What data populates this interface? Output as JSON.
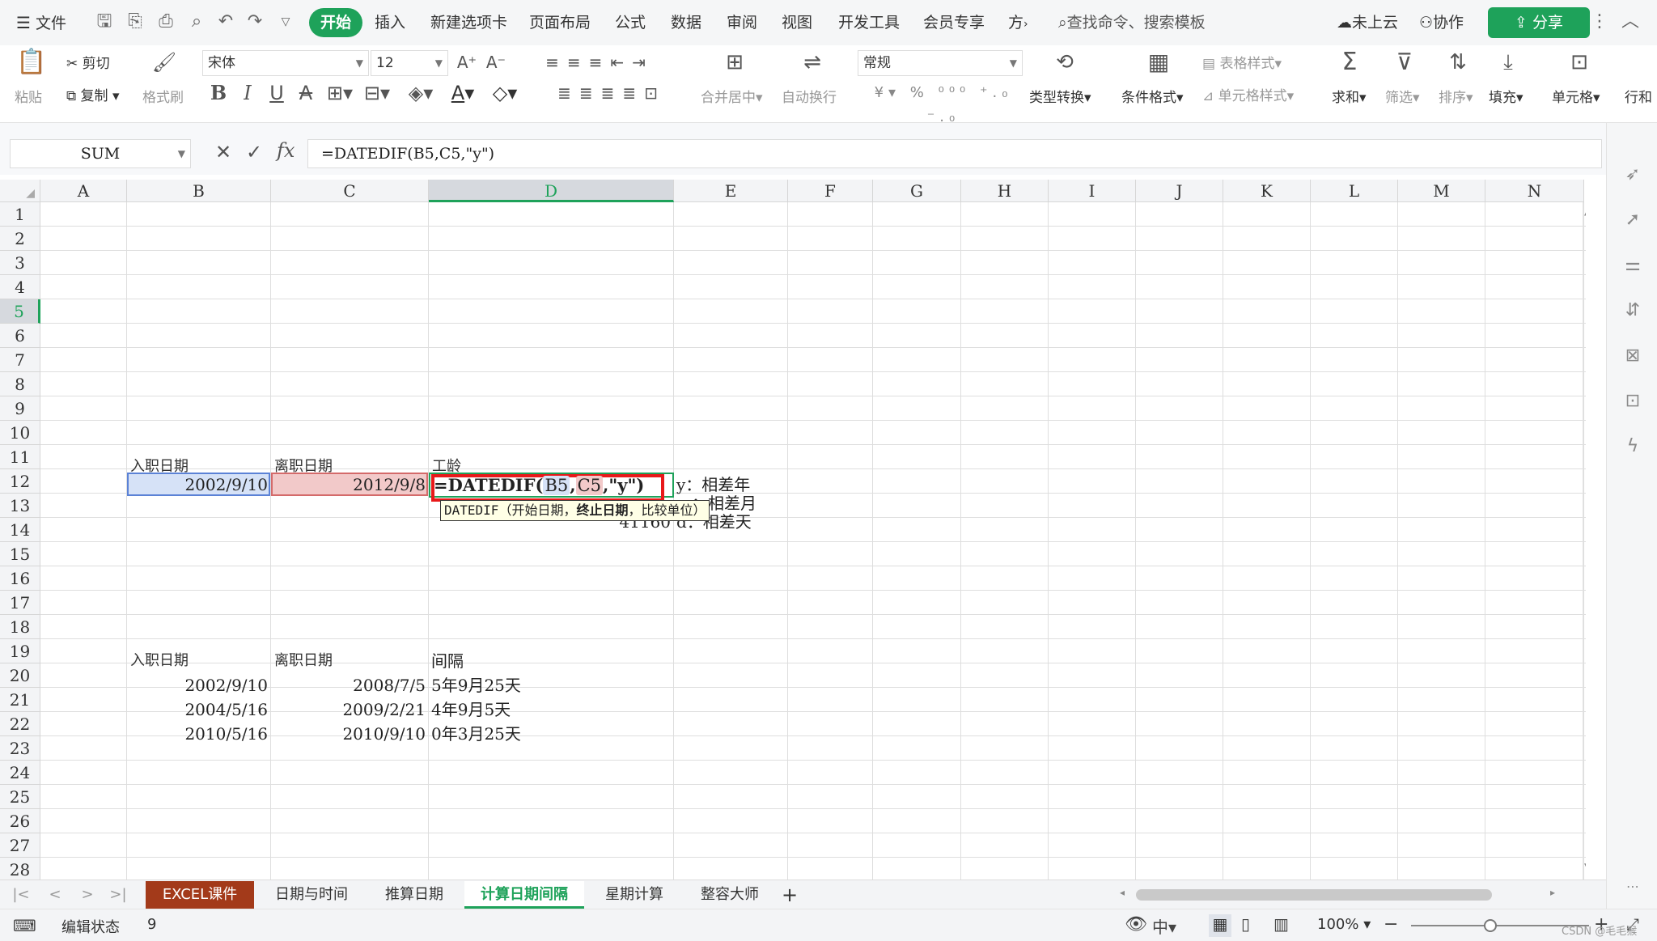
{
  "titlebar": {
    "menu_label": "文件",
    "tabs": [
      "开始",
      "插入",
      "新建选项卡",
      "页面布局",
      "公式",
      "数据",
      "审阅",
      "视图",
      "开发工具",
      "会员专享",
      "方"
    ],
    "search_placeholder": "查找命令、搜索模板",
    "cloud_label": "未上云",
    "collab_label": "协作",
    "share_label": "分享"
  },
  "ribbon": {
    "paste": "粘贴",
    "cut": "剪切",
    "copy": "复制",
    "format_painter": "格式刷",
    "font_name": "宋体",
    "font_size": "12",
    "merge_center": "合并居中",
    "auto_wrap": "自动换行",
    "number_format": "常规",
    "type_convert": "类型转换",
    "cond_format": "条件格式",
    "table_style": "表格样式",
    "cell_style": "单元格样式",
    "sum": "求和",
    "filter": "筛选",
    "sort": "排序",
    "fill": "填充",
    "cell": "单元格",
    "row_col": "行和"
  },
  "formula_bar": {
    "name_box": "SUM",
    "formula": "=DATEDIF(B5,C5,\"y\")"
  },
  "columns": [
    "A",
    "B",
    "C",
    "D",
    "E",
    "F",
    "G",
    "H",
    "I",
    "J",
    "K",
    "L",
    "M",
    "N"
  ],
  "rows": [
    "1",
    "2",
    "3",
    "4",
    "5",
    "6",
    "7",
    "8",
    "9",
    "10",
    "11",
    "12",
    "13",
    "14",
    "15",
    "16",
    "17",
    "18",
    "19",
    "20",
    "21",
    "22",
    "23",
    "24",
    "25",
    "26",
    "27",
    "28"
  ],
  "cells": {
    "B4": "入职日期",
    "C4": "离职日期",
    "D4": "工龄",
    "B5": "2002/9/10",
    "C5": "2012/9/8",
    "D5_prefix": "=DATEDIF(",
    "D5_ref1": "B5",
    "D5_comma1": ",",
    "D5_ref2": "C5",
    "D5_suffix": ",\"y\")",
    "E5": "y：相差年",
    "E6": "m：相差月",
    "D7": "41160",
    "E7": "d：相差天",
    "B12": "入职日期",
    "C12": "离职日期",
    "D12": "间隔",
    "B13": "2002/9/10",
    "C13": "2008/7/5",
    "D13": "5年9月25天",
    "B14": "2004/5/16",
    "C14": "2009/2/21",
    "D14": "4年9月5天",
    "B15": "2010/5/16",
    "C15": "2010/9/10",
    "D15": "0年3月25天"
  },
  "tooltip": {
    "fn": "DATEDIF",
    "arg1": "（开始日期，",
    "arg2": "终止日期",
    "arg3": "，比较单位）"
  },
  "sheet_tabs": [
    "EXCEL课件",
    "日期与时间",
    "推算日期",
    "计算日期间隔",
    "星期计算",
    "整容大师"
  ],
  "active_sheet": "计算日期间隔",
  "status": {
    "mode": "编辑状态",
    "count": "9",
    "zoom": "100%",
    "watermark": "CSDN @毛毛猴"
  },
  "colors": {
    "accent": "#1ea25a",
    "ref_blue": "#d6e2f7",
    "ref_red": "#f2c9c9",
    "highlight_box": "#e8191a",
    "first_tab": "#a33a1a"
  }
}
